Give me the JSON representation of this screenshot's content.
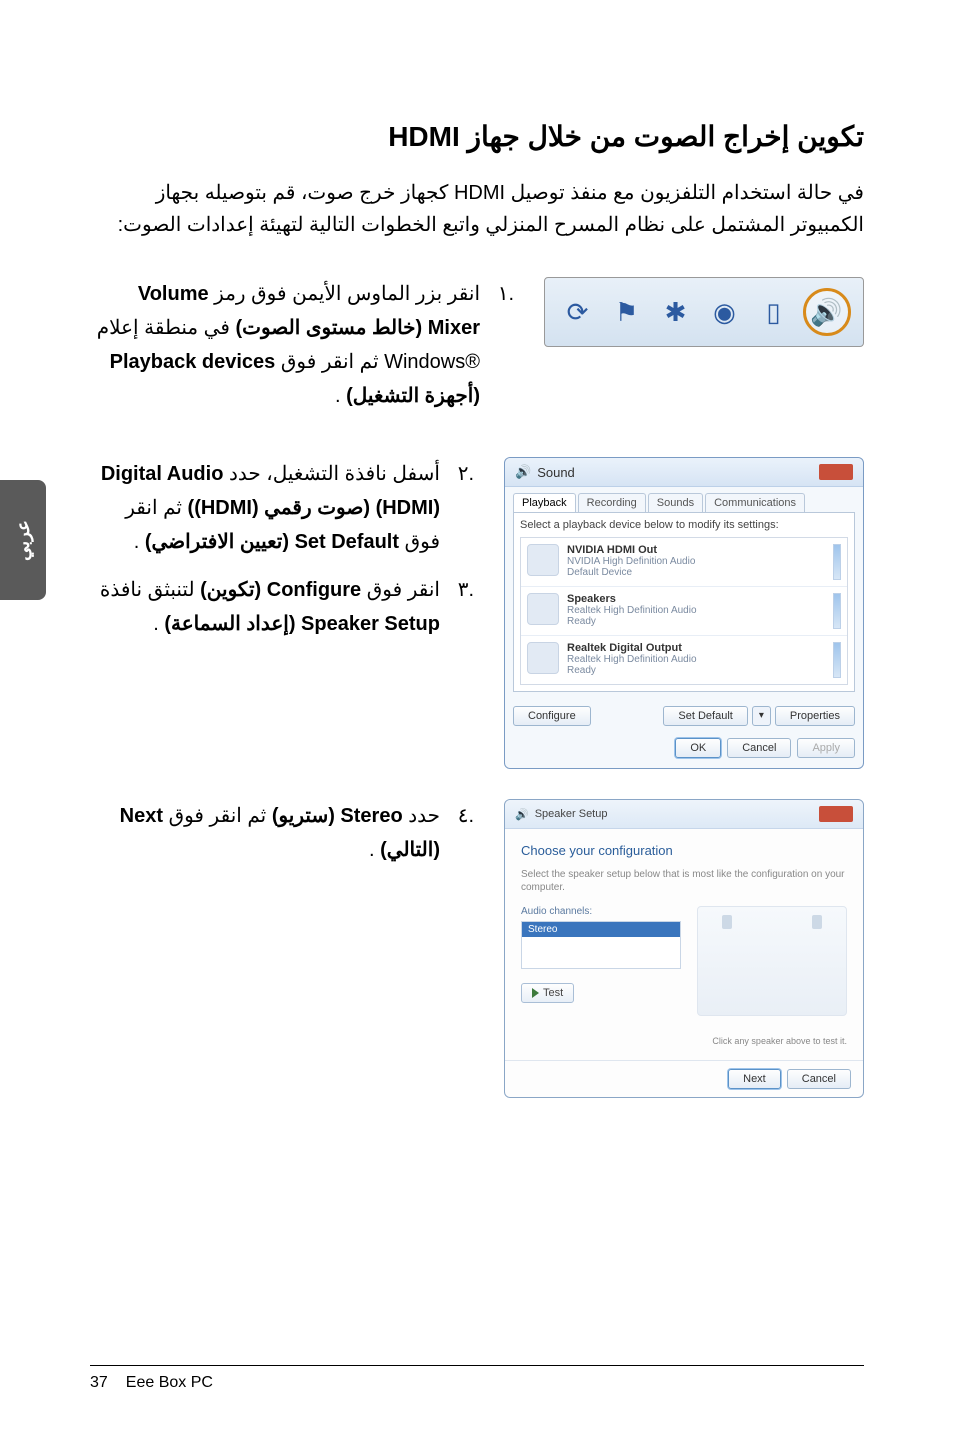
{
  "page": {
    "title": "تكوين إخراج الصوت من خلال جهاز HDMI",
    "intro": "في حالة استخدام التلفزيون مع منفذ توصيل HDMI كجهاز خرج صوت، قم بتوصيله بجهاز الكمبيوتر المشتمل على نظام المسرح المنزلي واتبع الخطوات التالية لتهيئة إعدادات الصوت:",
    "side_tab": "عربي",
    "footer_pagenum": "37",
    "footer_product": "Eee Box PC"
  },
  "steps": {
    "s1_num": ".١",
    "s1_a": "انقر بزر الماوس الأيمن فوق رمز ",
    "s1_b": "Volume Mixer (خالط مستوى الصوت)",
    "s1_c": " في منطقة إعلام ®Windows ثم انقر فوق ",
    "s1_d": "Playback devices (أجهزة التشغيل)",
    "s1_e": ".",
    "s2_num": ".٢",
    "s2_a": "أسفل نافذة التشغيل، حدد ",
    "s2_b": "Digital Audio (HDMI) (صوت رقمي (HDMI))",
    "s2_c": " ثم انقر فوق ",
    "s2_d": "Set Default (تعيين الافتراضي)",
    "s2_e": ".",
    "s3_num": ".٣",
    "s3_a": "انقر فوق ",
    "s3_b": "Configure (تكوين)",
    "s3_c": " لتنبثق نافذة ",
    "s3_d": "Speaker Setup (إعداد السماعة)",
    "s3_e": ".",
    "s4_num": ".٤",
    "s4_a": "حدد ",
    "s4_b": "Stereo (ستريو)",
    "s4_c": " ثم انقر فوق ",
    "s4_d": "Next (التالي)",
    "s4_e": "."
  },
  "sound_dialog": {
    "title": "Sound",
    "tab_playback": "Playback",
    "tab_recording": "Recording",
    "tab_sounds": "Sounds",
    "tab_comm": "Communications",
    "hint": "Select a playback device below to modify its settings:",
    "dev1_name": "NVIDIA HDMI Out",
    "dev1_sub": "NVIDIA High Definition Audio",
    "dev1_status": "Default Device",
    "dev2_name": "Speakers",
    "dev2_sub": "Realtek High Definition Audio",
    "dev2_status": "Ready",
    "dev3_name": "Realtek Digital Output",
    "dev3_sub": "Realtek High Definition Audio",
    "dev3_status": "Ready",
    "btn_configure": "Configure",
    "btn_setdefault": "Set Default",
    "btn_properties": "Properties",
    "btn_ok": "OK",
    "btn_cancel": "Cancel",
    "btn_apply": "Apply",
    "caret": "▾"
  },
  "setup_dialog": {
    "title": "Speaker Setup",
    "heading": "Choose your configuration",
    "desc": "Select the speaker setup below that is most like the configuration on your computer.",
    "list_header": "Audio channels:",
    "list_item": "Stereo",
    "btn_test": "Test",
    "click_hint": "Click any speaker above to test it.",
    "btn_next": "Next",
    "btn_cancel": "Cancel"
  }
}
